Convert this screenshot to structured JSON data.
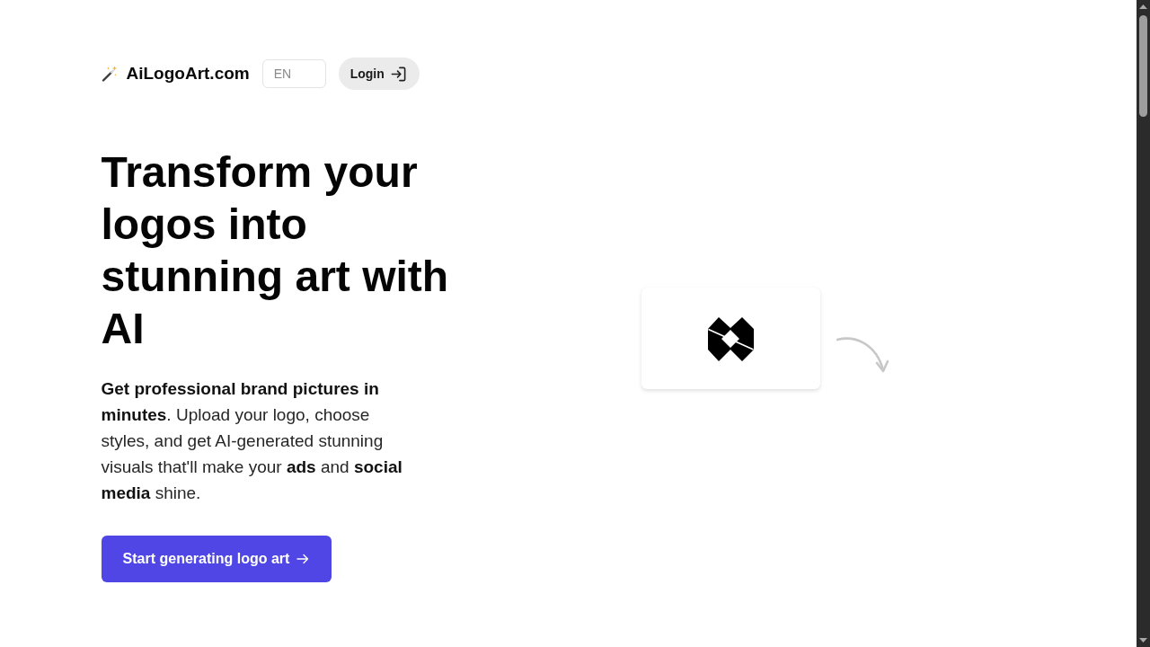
{
  "header": {
    "brand": "AiLogoArt.com",
    "language_select": {
      "value": "EN"
    },
    "login_button": {
      "label": "Login"
    }
  },
  "hero": {
    "headline": "Transform your logos into stunning art with AI",
    "description": "**Get professional brand pictures in minutes**. Upload your logo, choose styles, and get AI-generated stunning visuals that'll make your **ads** and **social media** shine.",
    "cta_button": {
      "label": "Start generating logo art"
    }
  }
}
